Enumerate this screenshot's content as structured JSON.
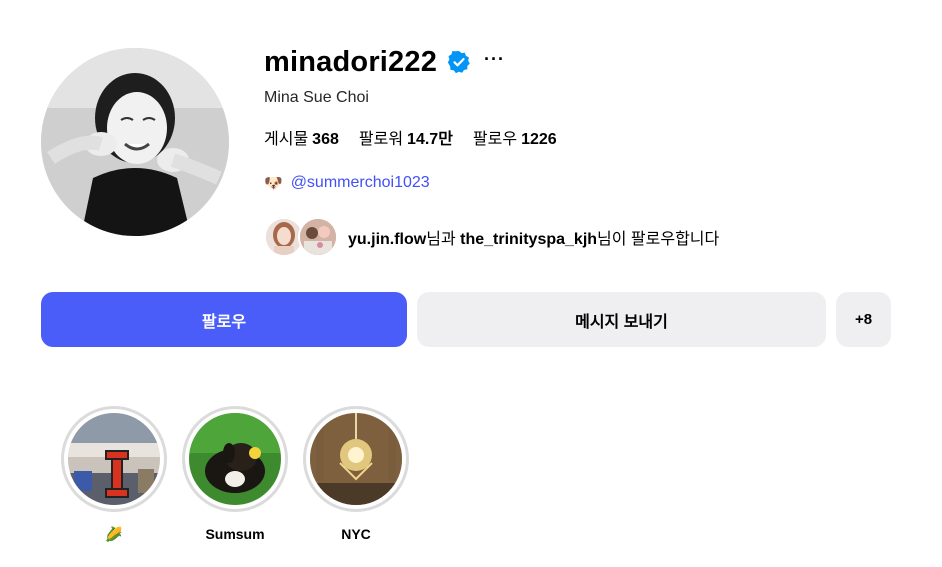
{
  "profile": {
    "username": "minadori222",
    "full_name": "Mina Sue Choi",
    "verified": true,
    "more_label": "···",
    "avatar_icon": "profile-photo"
  },
  "stats": [
    {
      "label": "게시물",
      "value": "368"
    },
    {
      "label": "팔로워",
      "value": "14.7만"
    },
    {
      "label": "팔로우",
      "value": "1226"
    }
  ],
  "threads": {
    "emoji": "🐶",
    "handle": "@summerchoi1023"
  },
  "followed_by": {
    "user1": "yu.jin.flow",
    "connector": "님과 ",
    "user2": "the_trinityspa_kjh",
    "suffix": "님이 팔로우합니다"
  },
  "buttons": {
    "follow": "팔로우",
    "message": "메시지 보내기",
    "add_user": "+8"
  },
  "highlights": [
    {
      "label": "🌽"
    },
    {
      "label": "Sumsum"
    },
    {
      "label": "NYC"
    }
  ],
  "colors": {
    "accent": "#4a5df9",
    "link": "#4150f7",
    "verified": "#0095f6",
    "secondary_button": "#efeff2"
  }
}
